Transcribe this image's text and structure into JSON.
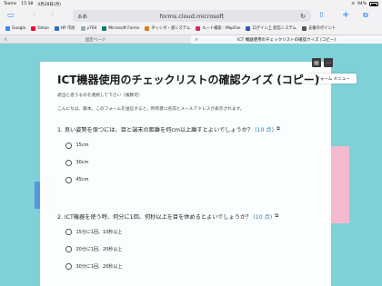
{
  "status": {
    "app": "Teams",
    "time": "15:38",
    "date": "4月28日(月)",
    "battery": "94%"
  },
  "toolbar": {
    "aa": "ぁあ",
    "url": "forms.cloud.microsoft"
  },
  "favorites": [
    {
      "label": "Google",
      "color": "#4285f4"
    },
    {
      "label": "Yahoo",
      "color": "#ff0033"
    },
    {
      "label": "HP 市民",
      "color": "#2a6bd6"
    },
    {
      "label": "y764",
      "color": "#9aa"
    },
    {
      "label": "Microsoft Forms",
      "color": "#0f7b6c"
    },
    {
      "label": "ヂッシボ・週システム",
      "color": "#e07a1f"
    },
    {
      "label": "ルート検索 - MapFan",
      "color": "#d62d5c"
    },
    {
      "label": "ログイン上 配信システム",
      "color": "#3355aa"
    },
    {
      "label": "支援のポイント",
      "color": "#555"
    }
  ],
  "tabs": {
    "inactive_label": "固定ページ",
    "active_label": "ICT 機器使用のチェックリストの確認クイズ (コピー)"
  },
  "form": {
    "menu_label": "フォーム メニュー",
    "title": "ICT機器使用のチェックリストの確認クイズ (コピー)",
    "instruction": "適当と思うものを選択して下さい（複数可）",
    "notice": "こんにちは、藤本。このフォームを送信すると、所有者に名前とメールアドレスが表示されます。",
    "questions": [
      {
        "text": "1. 良い姿勢を保つには、目と端末の距離を何cm以上離すとよいでしょうか？",
        "points": "(10 点)",
        "options": [
          "15cm",
          "30cm",
          "45cm"
        ]
      },
      {
        "text": "2. ICT機器を使う時、何分に1回、何秒以上を目を休めるとよいでしょうか？",
        "points": "(10 点)",
        "options": [
          "15分に1回、10秒以上",
          "20分に1回、20秒以上",
          "30分に1回、20秒以上"
        ]
      }
    ]
  }
}
